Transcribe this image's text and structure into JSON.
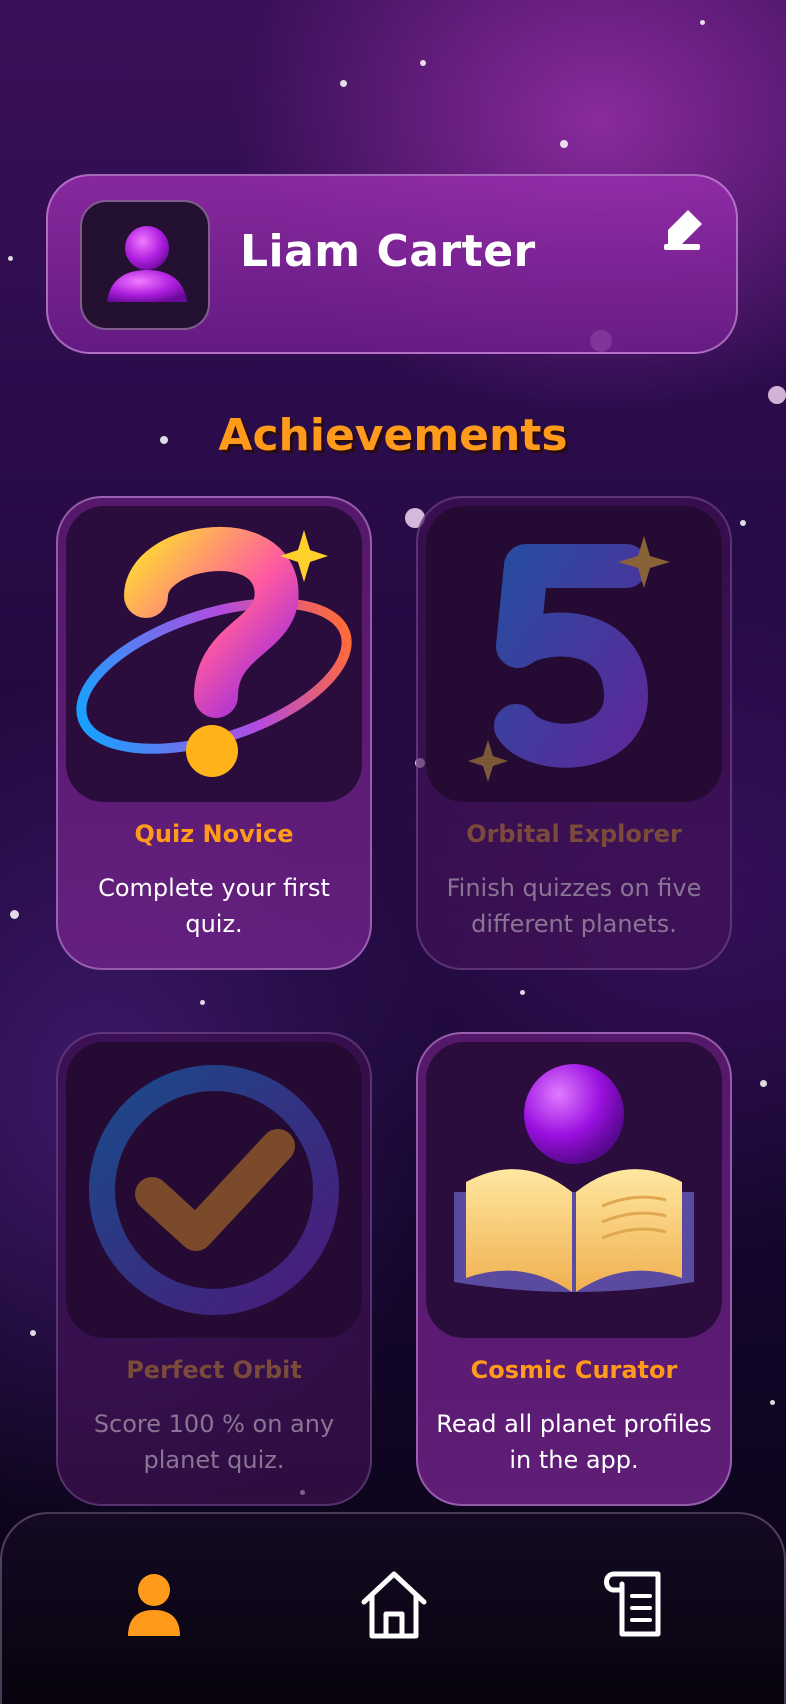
{
  "profile": {
    "name": "Liam Carter",
    "avatar_icon": "user-icon",
    "edit_icon": "pencil-icon"
  },
  "achievements_title": "Achievements",
  "achievements": [
    {
      "title": "Quiz Novice",
      "description": "Complete your first quiz.",
      "unlocked": true,
      "art": "question-orbit-icon"
    },
    {
      "title": "Orbital Explorer",
      "description": "Finish quizzes on five different planets.",
      "unlocked": false,
      "art": "number-five-icon"
    },
    {
      "title": "Perfect Orbit",
      "description": "Score 100 % on any planet quiz.",
      "unlocked": false,
      "art": "checkmark-ring-icon"
    },
    {
      "title": "Cosmic Curator",
      "description": "Read all planet profiles in the app.",
      "unlocked": true,
      "art": "book-planet-icon"
    }
  ],
  "bottom_nav": [
    {
      "icon": "profile-icon",
      "active": true
    },
    {
      "icon": "home-icon",
      "active": false
    },
    {
      "icon": "scroll-icon",
      "active": false
    }
  ],
  "colors": {
    "accent": "#ff9a1a",
    "card_bg": "#6e2387",
    "locked_text": "#8a7594"
  }
}
